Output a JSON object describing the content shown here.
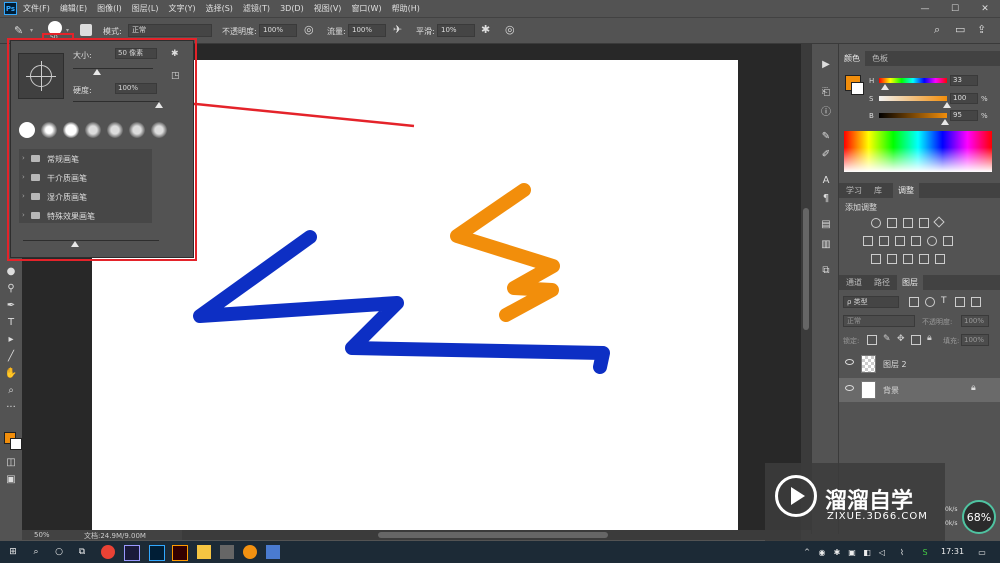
{
  "menubar": {
    "app_icon": "Ps",
    "items": [
      "文件(F)",
      "编辑(E)",
      "图像(I)",
      "图层(L)",
      "文字(Y)",
      "选择(S)",
      "滤镜(T)",
      "3D(D)",
      "视图(V)",
      "窗口(W)",
      "帮助(H)"
    ]
  },
  "options": {
    "brush_size_badge": "50",
    "mode_label": "模式:",
    "mode_value": "正常",
    "opacity_label": "不透明度:",
    "opacity_value": "100%",
    "flow_label": "流量:",
    "flow_value": "100%",
    "smooth_label": "平滑:",
    "smooth_value": "10%"
  },
  "brush_popup": {
    "size_label": "大小:",
    "size_value": "50 像素",
    "size_fraction": 0.3,
    "hardness_label": "硬度:",
    "hardness_value": "100%",
    "hardness_fraction": 1.0,
    "folders": [
      "常规画笔",
      "干介质画笔",
      "湿介质画笔",
      "特殊效果画笔"
    ]
  },
  "status": {
    "zoom": "50%",
    "doc": "文档:24.9M/9.00M"
  },
  "color_panel": {
    "tabs": [
      "颜色",
      "色板"
    ],
    "h_label": "H",
    "h_value": "33",
    "s_label": "S",
    "s_value": "100",
    "b_label": "B",
    "b_value": "95",
    "unit": "%",
    "foreground_color": "#f28e0b",
    "background_color": "#ffffff"
  },
  "adjust_panel": {
    "tabs": [
      "学习",
      "库",
      "调整"
    ],
    "title": "添加调整"
  },
  "layers_panel": {
    "tabs": [
      "通道",
      "路径",
      "图层"
    ],
    "filter_label": "ρ 类型",
    "blend_mode": "正常",
    "opacity_label": "不透明度:",
    "opacity_value": "100%",
    "lock_label": "锁定:",
    "fill_label": "填充:",
    "fill_value": "100%",
    "layers": [
      {
        "name": "图层 2"
      },
      {
        "name": "背景"
      }
    ]
  },
  "strokes": {
    "blue": "#0d2fc4",
    "orange": "#f28e0b"
  },
  "annotation": {
    "color": "#e4232a"
  },
  "watermark": {
    "title": "溜溜自学",
    "url": "ZIXUE.3D66.COM",
    "badge": "68%",
    "speed_up": "0k/s",
    "speed_down": "0k/s"
  },
  "taskbar": {
    "time": "17:31"
  }
}
